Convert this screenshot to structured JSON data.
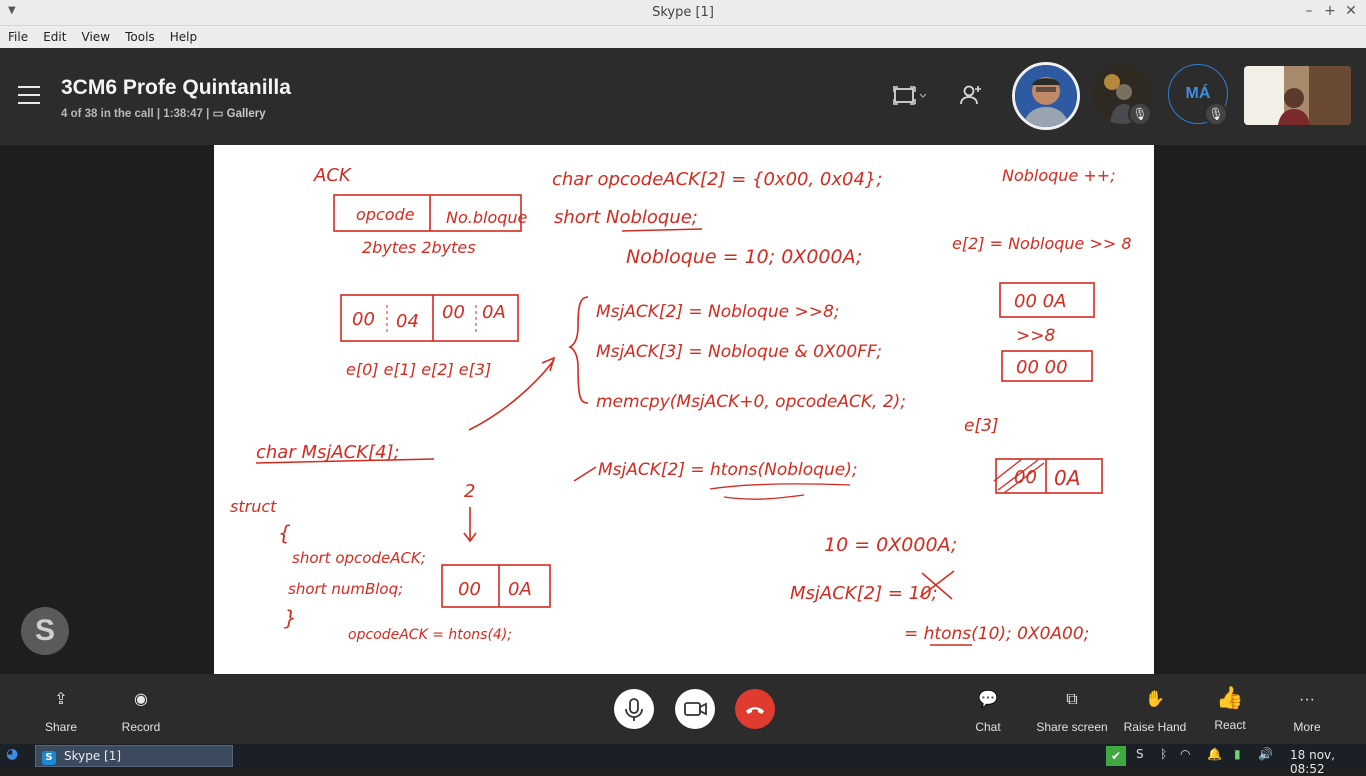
{
  "window": {
    "title": "Skype [1]"
  },
  "menu": {
    "items": [
      "File",
      "Edit",
      "View",
      "Tools",
      "Help"
    ]
  },
  "call": {
    "title": "3CM6 Profe Quintanilla",
    "participants": "4 of 38 in the call",
    "duration": "1:38:47",
    "view_mode": "Gallery",
    "avatar_initials": "MÁ"
  },
  "board": {
    "lines": [
      "ACK",
      "opcode | No.bloque",
      "2bytes   2bytes",
      "00 | 04 | 00 | 0A",
      "e[0]  e[1]  e[2]  e[3]",
      "char MsjACK[4];",
      "struct",
      "{",
      "short opcodeACK;",
      "short numBloq;",
      "}",
      "2",
      "00 | 0A",
      "opcodeACK = htons(4);",
      "char opcodeACK[2] = {0x00, 0x04};",
      "short Nobloque;",
      "Nobloque = 10;    0X000A;",
      "MsjACK[2] = Nobloque >>8;",
      "MsjACK[3] = Nobloque & 0X00FF;",
      "memcpy(MsjACK+0, opcodeACK, 2);",
      "MsjACK[2] = htons(Nobloque);",
      "10 = 0X000A;",
      "MsjACK[2] = 10;",
      "= htons(10);   0X0A00;",
      "Nobloque ++;",
      "e[2] = Nobloque >> 8",
      "00 0A",
      ">>8",
      "00 00",
      "e[3]",
      "00 | 0A"
    ]
  },
  "controls": {
    "share": "Share",
    "record": "Record",
    "chat": "Chat",
    "share_screen": "Share screen",
    "raise_hand": "Raise Hand",
    "react": "React",
    "more": "More"
  },
  "taskbar": {
    "app": "Skype [1]",
    "clock": "18 nov, 08:52"
  },
  "colors": {
    "ink": "#d42a1f",
    "end_call": "#e03b2f",
    "header": "#2c2c2c"
  }
}
